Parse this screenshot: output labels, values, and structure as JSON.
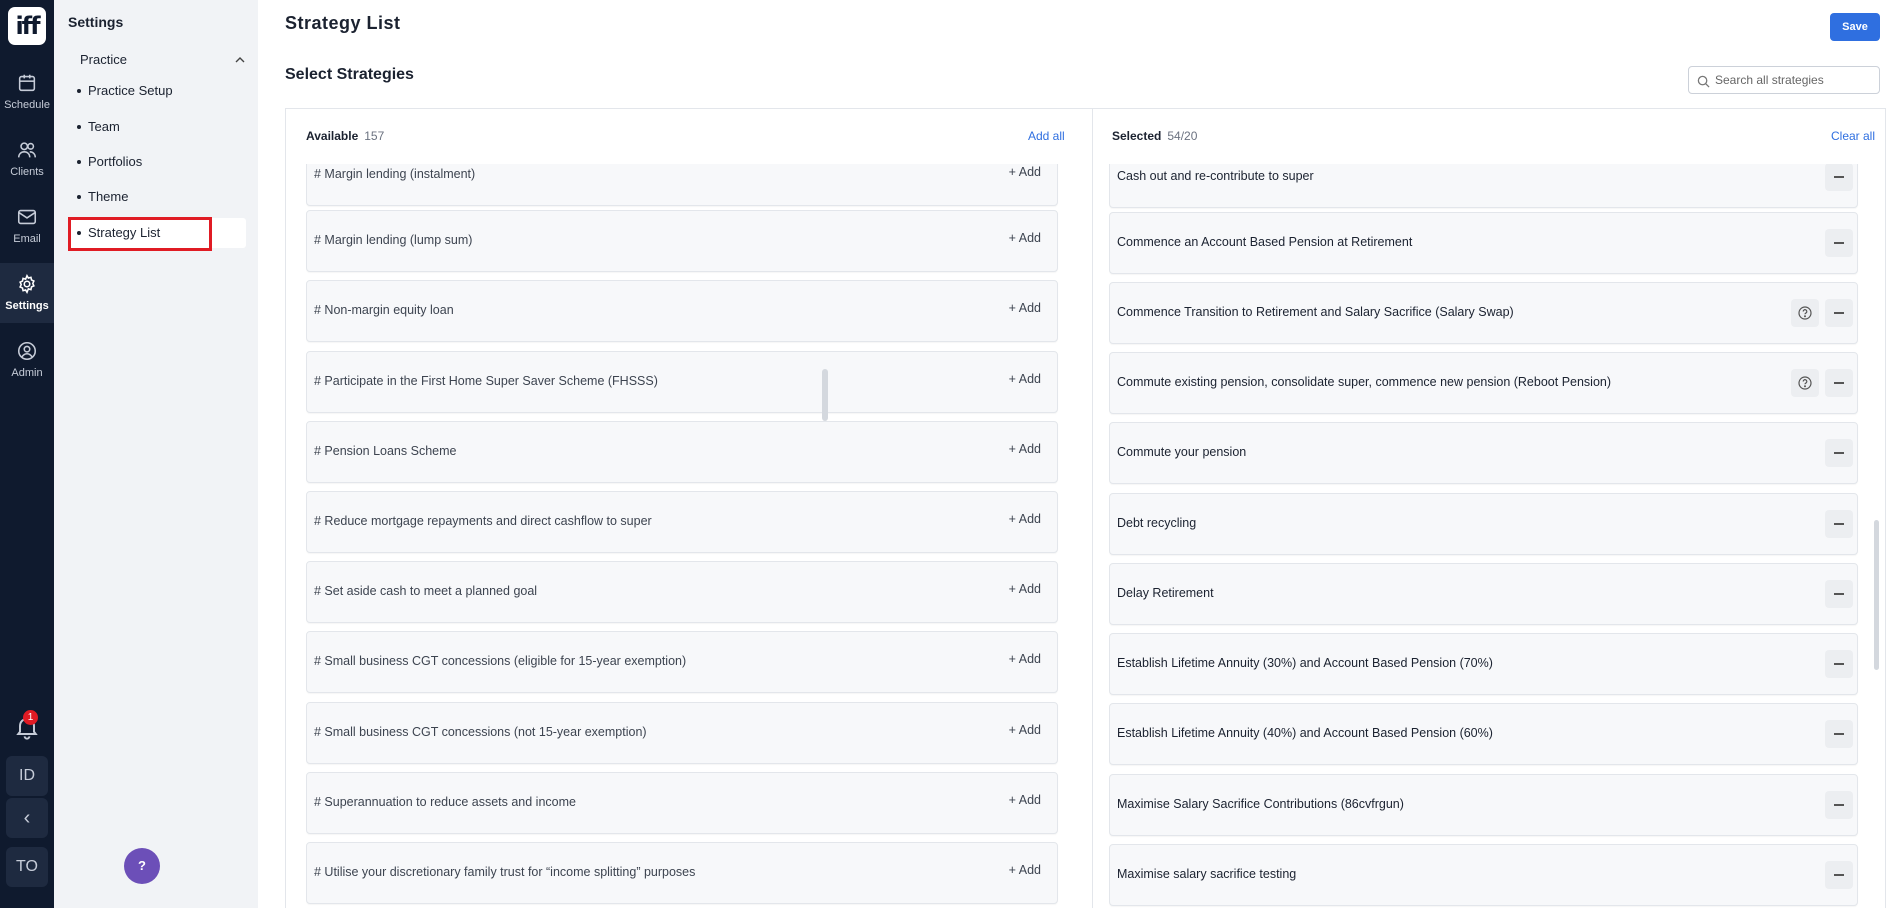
{
  "app": {
    "logo_text": "iff"
  },
  "rail": {
    "items": [
      {
        "label": "Schedule",
        "icon": "calendar-icon"
      },
      {
        "label": "Clients",
        "icon": "users-icon"
      },
      {
        "label": "Email",
        "icon": "mail-icon"
      },
      {
        "label": "Settings",
        "icon": "gear-icon"
      },
      {
        "label": "Admin",
        "icon": "user-circle-icon"
      }
    ],
    "notification_count": "1",
    "id_label": "ID",
    "collapse_glyph": "‹",
    "user_initials": "TO"
  },
  "sidebar": {
    "title": "Settings",
    "section": "Practice",
    "items": [
      {
        "label": "Practice Setup"
      },
      {
        "label": "Team"
      },
      {
        "label": "Portfolios"
      },
      {
        "label": "Theme"
      },
      {
        "label": "Strategy List"
      }
    ],
    "help_label": "?"
  },
  "header": {
    "title": "Strategy List",
    "save_label": "Save",
    "section_title": "Select Strategies",
    "search_placeholder": "Search all strategies"
  },
  "available": {
    "label": "Available",
    "count": "157",
    "action": "Add all",
    "add_label": "+ Add",
    "items": [
      "# Margin lending (instalment)",
      "# Margin lending (lump sum)",
      "# Non-margin equity loan",
      "# Participate in the First Home Super Saver Scheme (FHSSS)",
      "# Pension Loans Scheme",
      "# Reduce mortgage repayments and direct cashflow to super",
      "# Set aside cash to meet a planned goal",
      "# Small business CGT concessions (eligible for 15-year exemption)",
      "# Small business CGT concessions (not 15-year exemption)",
      "# Superannuation to reduce assets and income",
      "# Utilise your discretionary family trust for “income splitting” purposes"
    ]
  },
  "selected": {
    "label": "Selected",
    "count": "54/20",
    "action": "Clear all",
    "items": [
      {
        "text": "Cash out and re-contribute to super",
        "info": false
      },
      {
        "text": "Commence an Account Based Pension at Retirement",
        "info": false
      },
      {
        "text": "Commence Transition to Retirement and Salary Sacrifice (Salary Swap)",
        "info": true
      },
      {
        "text": "Commute existing pension, consolidate super, commence new pension (Reboot Pension)",
        "info": true
      },
      {
        "text": "Commute your pension",
        "info": false
      },
      {
        "text": "Debt recycling",
        "info": false
      },
      {
        "text": "Delay Retirement",
        "info": false
      },
      {
        "text": "Establish Lifetime Annuity (30%) and Account Based Pension (70%)",
        "info": false
      },
      {
        "text": "Establish Lifetime Annuity (40%) and Account Based Pension (60%)",
        "info": false
      },
      {
        "text": "Maximise Salary Sacrifice Contributions (86cvfrgun)",
        "info": false
      },
      {
        "text": "Maximise salary sacrifice testing",
        "info": false
      }
    ]
  },
  "colors": {
    "rail_bg": "#0f1a2e",
    "accent": "#2f6fe0",
    "highlight": "#e01b24",
    "help_bg": "#6c4fb8"
  }
}
